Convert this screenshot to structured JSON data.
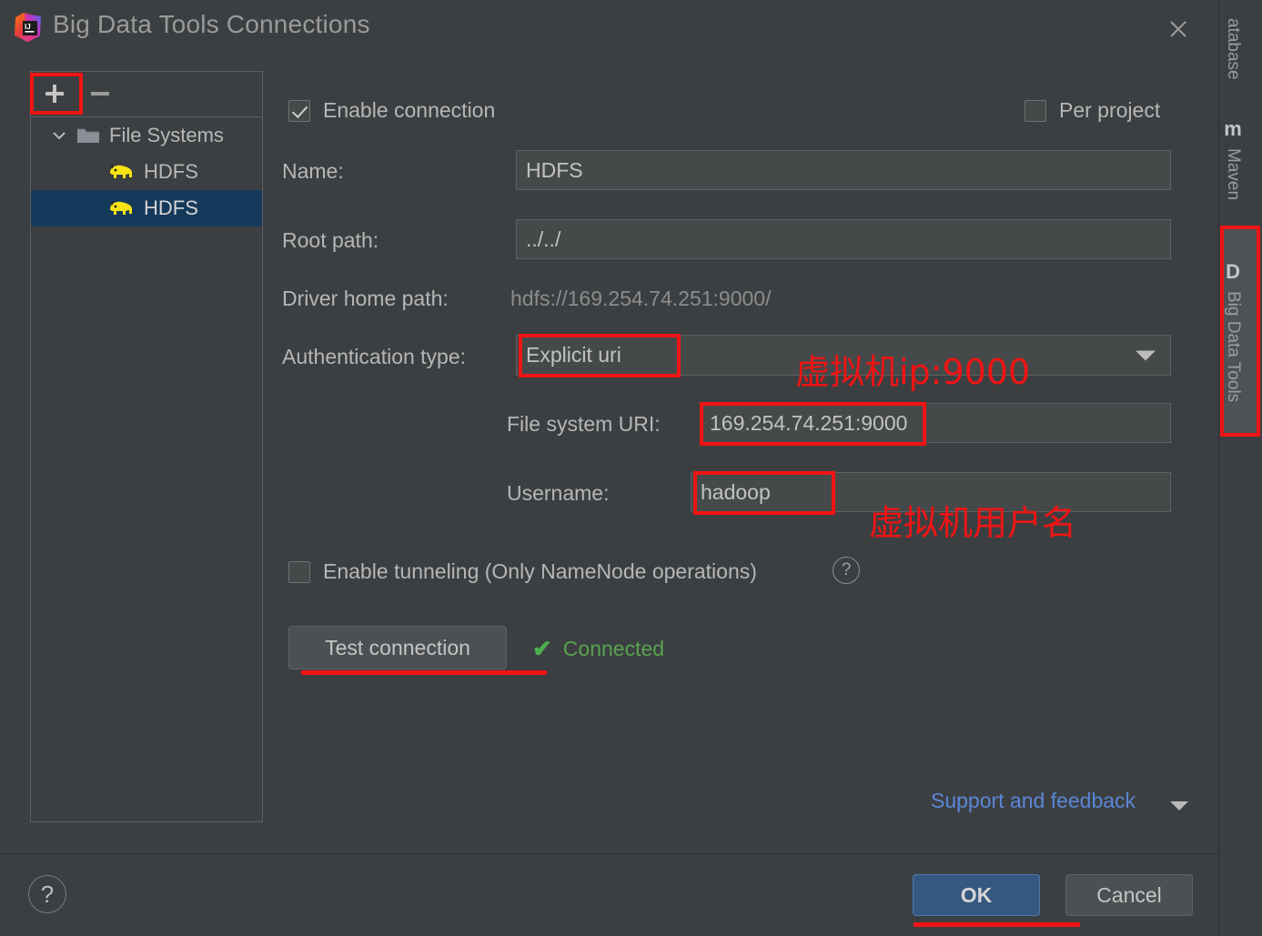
{
  "window": {
    "title": "Big Data Tools Connections",
    "logo_icon": "intellij-idea-logo",
    "close_icon": "close-icon"
  },
  "tree_panel": {
    "toolbar": {
      "add_label": "+",
      "add_icon": "plus-icon",
      "remove_label": "−",
      "remove_icon": "minus-icon"
    },
    "items": [
      {
        "label": "File Systems",
        "icon": "folder-icon",
        "expanded": true,
        "selected": false,
        "level": 0
      },
      {
        "label": "HDFS",
        "icon": "hadoop-elephant-icon",
        "selected": false,
        "level": 1
      },
      {
        "label": "HDFS",
        "icon": "hadoop-elephant-icon",
        "selected": true,
        "level": 1
      }
    ]
  },
  "form": {
    "enable_connection": {
      "label": "Enable connection",
      "checked": true
    },
    "per_project": {
      "label": "Per project",
      "checked": false
    },
    "name": {
      "label": "Name:",
      "value": "HDFS"
    },
    "root_path": {
      "label": "Root path:",
      "value": "../../"
    },
    "driver_home_path": {
      "label": "Driver home path:",
      "value": "hdfs://169.254.74.251:9000/"
    },
    "authentication_type": {
      "label": "Authentication type:",
      "value": "Explicit uri",
      "arrow_icon": "chevron-down-icon"
    },
    "file_system_uri": {
      "label": "File system URI:",
      "value": "169.254.74.251:9000"
    },
    "username": {
      "label": "Username:",
      "value": "hadoop"
    },
    "enable_tunneling": {
      "label": "Enable tunneling (Only NameNode operations)",
      "checked": false,
      "help_icon": "help-circle-icon",
      "help_glyph": "?"
    },
    "test_connection": {
      "label": "Test connection"
    },
    "connection_status": {
      "label": "Connected",
      "icon": "check-icon",
      "glyph": "✔",
      "color": "#58a34f"
    },
    "support_feedback": {
      "label": "Support and feedback",
      "arrow_icon": "chevron-down-icon"
    }
  },
  "footer": {
    "help": {
      "glyph": "?",
      "icon": "help-circle-icon"
    },
    "ok": {
      "label": "OK"
    },
    "cancel": {
      "label": "Cancel"
    }
  },
  "tool_strip": {
    "tabs": [
      {
        "label": "atabase",
        "icon": "",
        "active": false
      },
      {
        "label": "Maven",
        "icon": "m",
        "active": false
      },
      {
        "label": "Big Data Tools",
        "icon": "D",
        "active": true
      }
    ]
  },
  "annotations": {
    "color": "#f01414",
    "texts": [
      {
        "text": "虚拟机ip:9000"
      },
      {
        "text": "虚拟机用户名"
      }
    ]
  }
}
